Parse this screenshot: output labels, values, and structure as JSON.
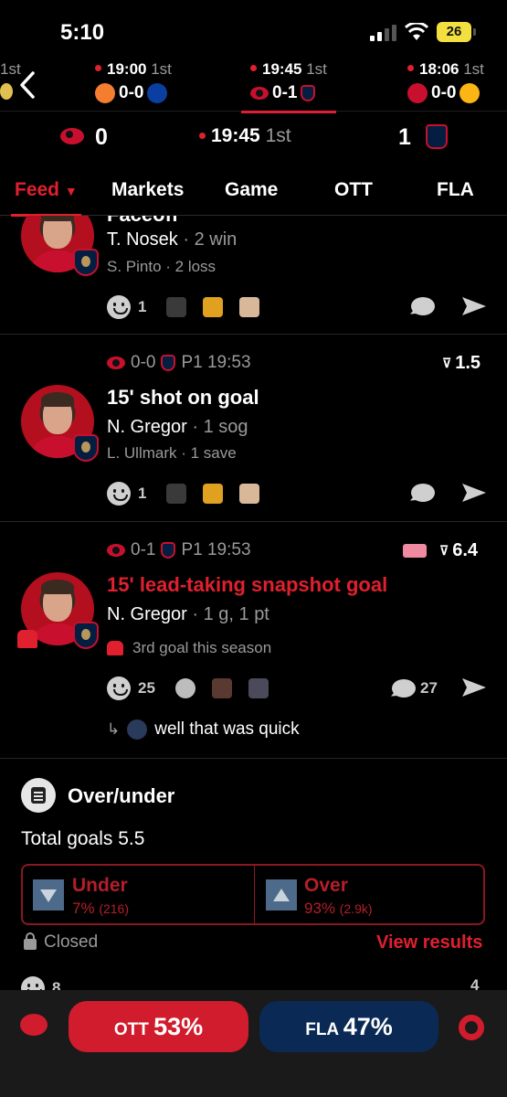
{
  "status": {
    "time": "5:10",
    "battery": "26"
  },
  "games": [
    {
      "time": "",
      "period": "1st",
      "score": ""
    },
    {
      "time": "19:00",
      "period": "1st",
      "score": "0-0"
    },
    {
      "time": "19:45",
      "period": "1st",
      "score": "0-1"
    },
    {
      "time": "18:06",
      "period": "1st",
      "score": "0-0"
    }
  ],
  "scoreboard": {
    "home_score": "0",
    "clock": "19:45",
    "period": "1st",
    "away_score": "1"
  },
  "tabs": [
    "Feed",
    "Markets",
    "Game",
    "OTT",
    "FLA"
  ],
  "feed": [
    {
      "header_partial": "Faceoff",
      "line1_name": "T. Nosek",
      "line1_stat": "· 2 win",
      "line2": "S. Pinto · 2 loss",
      "reaction_count": "1"
    },
    {
      "score": "0-0",
      "time": "P1 19:53",
      "odds": "1.5",
      "headline": "15' shot on goal",
      "line1_name": "N. Gregor",
      "line1_stat": "· 1 sog",
      "line2": "L. Ullmark · 1 save",
      "reaction_count": "1"
    },
    {
      "score": "0-1",
      "time": "P1 19:53",
      "odds": "6.4",
      "headline": "15' lead-taking snapshot goal",
      "line1_name": "N. Gregor",
      "line1_stat": "· 1 g, 1 pt",
      "note": "3rd goal this season",
      "reaction_count": "25",
      "comment_count": "27",
      "reply": "well that was quick"
    }
  ],
  "poll": {
    "title": "Over/under",
    "question": "Total goals 5.5",
    "under": {
      "label": "Under",
      "pct": "7%",
      "count": "(216)"
    },
    "over": {
      "label": "Over",
      "pct": "93%",
      "count": "(2.9k)"
    },
    "status": "Closed",
    "view_results": "View results",
    "footer_counts": [
      "8",
      "4"
    ]
  },
  "bottom": {
    "ott_label": "OTT",
    "ott_pct": "53%",
    "fla_label": "FLA",
    "fla_pct": "47%"
  },
  "colors": {
    "accent": "#e0202e",
    "fla_blue": "#0a2a55",
    "background": "#000000"
  }
}
